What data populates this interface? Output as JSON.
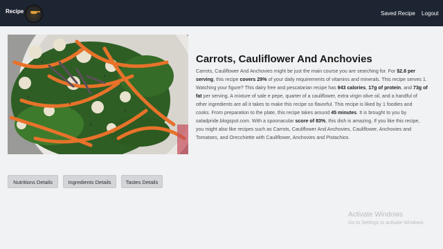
{
  "navbar": {
    "brand": "Recipe",
    "logo_icon": "frying-pan-logo-icon",
    "links": [
      "Saved Recipe",
      "Logout"
    ]
  },
  "recipe": {
    "title": "Carrots, Cauliflower And Anchovies",
    "image_alt": "salad-photo",
    "summary": {
      "p1": "Carrots, Cauliflower And Anchovies might be just the main course you are searching for. For ",
      "price": "$2.8 per serving",
      "p2": ", this recipe ",
      "coverage": "covers 29%",
      "p3": " of your daily requirements of vitamins and minerals. This recipe serves 1. Watching your figure? This dairy free and pescatarian recipe has ",
      "calories": "943 calories",
      "sep1": ", ",
      "protein": "17g of protein",
      "sep2": ", and ",
      "fat": "73g of fat",
      "p4": " per serving. A mixture of sale e pepe, quarter of a cauliflower, extra virgin olive oil, and a handful of other ingredients are all it takes to make this recipe so flavorful. This recipe is liked by 1 foodies and cooks. From preparation to the plate, this recipe takes around ",
      "time": "45 minutes",
      "p5": ". It is brought to you by saladpride.blogspot.com. With a spoonacular ",
      "score": "score of 83%",
      "p6": ", this dish is amazing. If you like this recipe, you might also like recipes such as Carrots, Cauliflower And Anchovies, Cauliflower, Anchovies and Tomatoes, and Orecchiette with Cauliflower, Anchovies and Pistachios."
    }
  },
  "buttons": {
    "nutrition": "Nutritions Details",
    "ingredients": "Ingredients Details",
    "tastes": "Tastes Details"
  },
  "watermark": {
    "title": "Activate Windows",
    "subtitle": "Go to Settings to activate Windows."
  },
  "colors": {
    "navbar_bg": "#1e2532",
    "page_bg": "#f1f2f4",
    "button_bg": "#d3d5d8"
  }
}
